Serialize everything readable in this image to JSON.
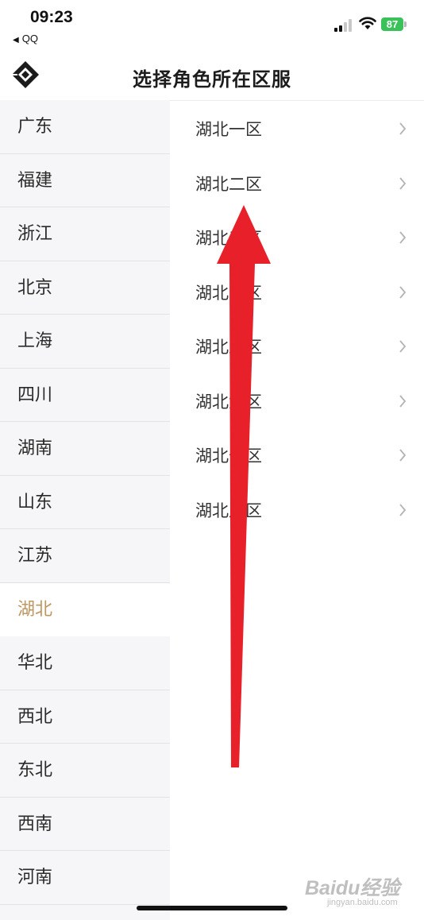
{
  "status_bar": {
    "time": "09:23",
    "back_app": "QQ",
    "battery": "87"
  },
  "header": {
    "title": "选择角色所在区服",
    "logo_icon": "diamond-logo-icon"
  },
  "regions": [
    {
      "label": "广东"
    },
    {
      "label": "福建"
    },
    {
      "label": "浙江"
    },
    {
      "label": "北京"
    },
    {
      "label": "上海"
    },
    {
      "label": "四川"
    },
    {
      "label": "湖南"
    },
    {
      "label": "山东"
    },
    {
      "label": "江苏"
    },
    {
      "label": "湖北",
      "selected": true
    },
    {
      "label": "华北"
    },
    {
      "label": "西北"
    },
    {
      "label": "东北"
    },
    {
      "label": "西南"
    },
    {
      "label": "河南"
    }
  ],
  "servers": [
    {
      "label": "湖北一区"
    },
    {
      "label": "湖北二区"
    },
    {
      "label": "湖北三区"
    },
    {
      "label": "湖北四区"
    },
    {
      "label": "湖北五区"
    },
    {
      "label": "湖北六区"
    },
    {
      "label": "湖北七区"
    },
    {
      "label": "湖北八区"
    }
  ],
  "colors": {
    "selected_region_text": "#bf9560",
    "left_panel_bg": "#f6f5f7",
    "annotation_arrow": "#e8202a",
    "battery_green": "#39c15a"
  },
  "watermark": {
    "main": "Baidu经验",
    "sub": "jingyan.baidu.com"
  }
}
